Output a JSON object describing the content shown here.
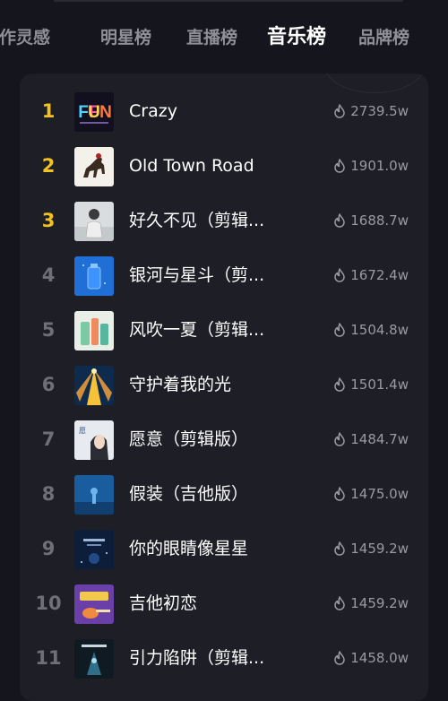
{
  "tabs": [
    {
      "label": "创作灵感",
      "active": false
    },
    {
      "label": "明星榜",
      "active": false
    },
    {
      "label": "直播榜",
      "active": false
    },
    {
      "label": "音乐榜",
      "active": true
    },
    {
      "label": "品牌榜",
      "active": false
    }
  ],
  "rank_colors": {
    "top": "#f4c21c",
    "normal": "#6f6f78"
  },
  "songs": [
    {
      "rank": "1",
      "title": "Crazy",
      "heat": "2739.5w",
      "cover": "fun-cover"
    },
    {
      "rank": "2",
      "title": "Old Town Road",
      "heat": "1901.0w",
      "cover": "horse-cover"
    },
    {
      "rank": "3",
      "title": "好久不见（剪辑...",
      "heat": "1688.7w",
      "cover": "person-light-cover"
    },
    {
      "rank": "4",
      "title": "银河与星斗（剪...",
      "heat": "1672.4w",
      "cover": "blue-bottle-cover"
    },
    {
      "rank": "5",
      "title": "风吹一夏（剪辑...",
      "heat": "1504.8w",
      "cover": "green-drinks-cover"
    },
    {
      "rank": "6",
      "title": "守护着我的光",
      "heat": "1501.4w",
      "cover": "sunrays-cover"
    },
    {
      "rank": "7",
      "title": "愿意（剪辑版）",
      "heat": "1484.7w",
      "cover": "girl-portrait-cover"
    },
    {
      "rank": "8",
      "title": "假装（吉他版）",
      "heat": "1475.0w",
      "cover": "blue-night-cover"
    },
    {
      "rank": "9",
      "title": "你的眼睛像星星",
      "heat": "1459.2w",
      "cover": "dark-blue-cover"
    },
    {
      "rank": "10",
      "title": "吉他初恋",
      "heat": "1459.2w",
      "cover": "purple-guitar-cover"
    },
    {
      "rank": "11",
      "title": "引力陷阱（剪辑...",
      "heat": "1458.0w",
      "cover": "dark-teal-cover"
    }
  ]
}
